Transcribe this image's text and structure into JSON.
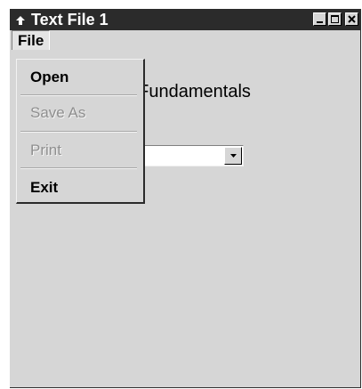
{
  "window": {
    "title": "Text File 1"
  },
  "menu_bar": {
    "file_label": "File"
  },
  "file_menu": {
    "items": [
      {
        "label": "Open",
        "enabled": true
      },
      {
        "label": "Save As",
        "enabled": false
      },
      {
        "label": "Print",
        "enabled": false
      },
      {
        "label": "Exit",
        "enabled": true
      }
    ]
  },
  "form": {
    "heading_visible": "le Fundamentals",
    "combo_value": ""
  },
  "icons": {
    "system_menu": "window-system-icon",
    "minimize": "minimize-icon",
    "maximize": "maximize-icon",
    "close": "close-icon",
    "combo_arrow": "chevron-down-icon"
  },
  "colors": {
    "title_bar": "#2b2b2b",
    "window_face": "#d6d6d6",
    "disabled_text": "#8f8f8f"
  }
}
